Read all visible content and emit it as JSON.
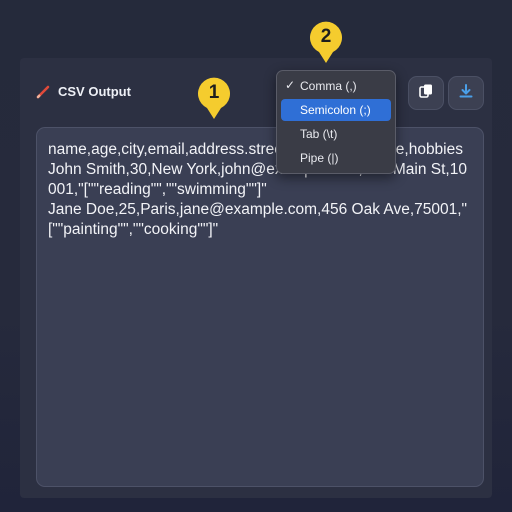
{
  "header": {
    "title": "CSV Output",
    "icon": "pencil-icon"
  },
  "toolbar": {
    "copy_icon": "copy-icon",
    "download_icon": "download-icon"
  },
  "output": {
    "text": "name,age,city,email,address.street,address.zipcode,hobbies\nJohn Smith,30,New York,john@example.com,123 Main St,10001,\"[\"\"reading\"\",\"\"swimming\"\"]\"\nJane Doe,25,Paris,jane@example.com,456 Oak Ave,75001,\"[\"\"painting\"\",\"\"cooking\"\"]\""
  },
  "delimiter_menu": {
    "items": [
      {
        "label": "Comma (,)",
        "checked": true
      },
      {
        "label": "Semicolon (;)",
        "highlighted": true
      },
      {
        "label": "Tab (\\t)"
      },
      {
        "label": "Pipe (|)"
      }
    ],
    "checkmark": "✓"
  },
  "annotations": {
    "marker1": "1",
    "marker2": "2",
    "color": "#f5cc2e"
  },
  "colors": {
    "accent": "#2f6fd6",
    "pencil": "#e04a3a",
    "download_icon": "#4a9fe8"
  }
}
